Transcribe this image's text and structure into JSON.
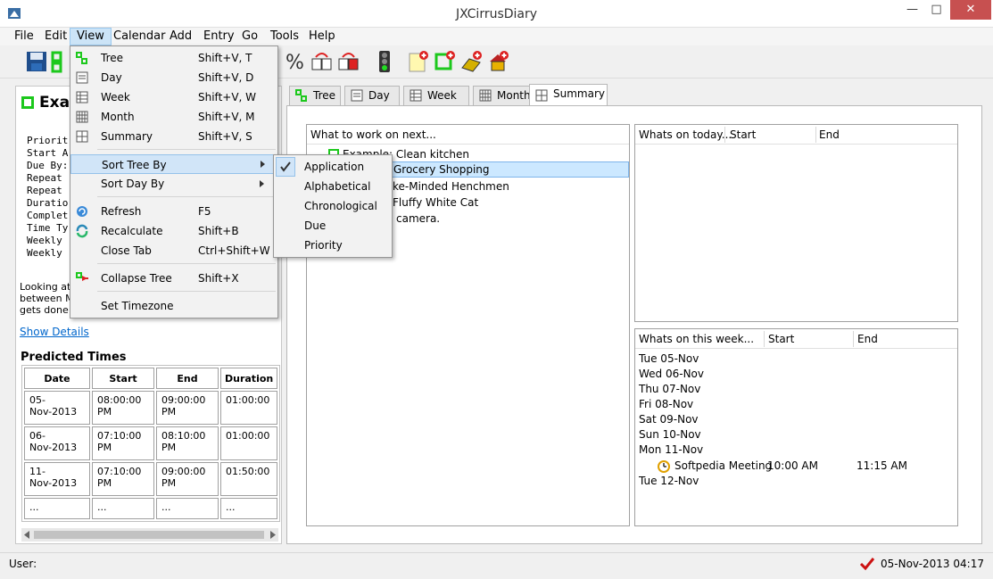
{
  "window": {
    "title": "JXCirrusDiary",
    "minimize": "—",
    "maximize": "□",
    "close": "✕"
  },
  "menubar": [
    "File",
    "Edit",
    "View",
    "Calendar",
    "Add",
    "Entry",
    "Go",
    "Tools",
    "Help"
  ],
  "left": {
    "entry_title": "Exa",
    "fields": [
      "Priorit",
      "Start A",
      "Due By:",
      "Repeat",
      "Repeat",
      "Duratio",
      "Complet",
      "Time Ty",
      "Weekly",
      "Weekly"
    ],
    "description": "Looking at t\nbetween Mo\ngets done b",
    "show_details": "Show Details",
    "predicted_title": "Predicted Times",
    "columns": [
      "Date",
      "Start",
      "End",
      "Duration"
    ],
    "rows": [
      [
        "05-\nNov-2013",
        "08:00:00\nPM",
        "09:00:00\nPM",
        "01:00:00"
      ],
      [
        "06-\nNov-2013",
        "07:10:00\nPM",
        "08:10:00\nPM",
        "01:00:00"
      ],
      [
        "11-\nNov-2013",
        "07:10:00\nPM",
        "09:00:00\nPM",
        "01:50:00"
      ],
      [
        "...",
        "...",
        "...",
        "..."
      ]
    ]
  },
  "tabs": [
    "Tree",
    "Day",
    "Week",
    "Month",
    "Summary"
  ],
  "work_next": {
    "header": "What to work on next...",
    "items": [
      "Example: Clean kitchen",
      "Grocery Shopping",
      "ke-Minded Henchmen",
      "Fluffy White Cat",
      "camera."
    ]
  },
  "today": {
    "header": "Whats on today...",
    "start": "Start",
    "end": "End"
  },
  "week": {
    "header": "Whats on this week...",
    "start": "Start",
    "end": "End",
    "days": [
      "Tue 05-Nov",
      "Wed 06-Nov",
      "Thu 07-Nov",
      "Fri 08-Nov",
      "Sat 09-Nov",
      "Sun 10-Nov",
      "Mon 11-Nov"
    ],
    "event": {
      "name": "Softpedia Meeting",
      "start": "10:00 AM",
      "end": "11:15 AM"
    },
    "last_day": "Tue 12-Nov"
  },
  "view_menu": {
    "items": [
      {
        "label": "Tree",
        "shortcut": "Shift+V, T"
      },
      {
        "label": "Day",
        "shortcut": "Shift+V, D"
      },
      {
        "label": "Week",
        "shortcut": "Shift+V, W"
      },
      {
        "label": "Month",
        "shortcut": "Shift+V, M"
      },
      {
        "label": "Summary",
        "shortcut": "Shift+V, S"
      },
      {
        "label": "Sort Tree By",
        "shortcut": ""
      },
      {
        "label": "Sort Day By",
        "shortcut": ""
      },
      {
        "label": "Refresh",
        "shortcut": "F5"
      },
      {
        "label": "Recalculate",
        "shortcut": "Shift+B"
      },
      {
        "label": "Close Tab",
        "shortcut": "Ctrl+Shift+W"
      },
      {
        "label": "Collapse Tree",
        "shortcut": "Shift+X"
      },
      {
        "label": "Set Timezone",
        "shortcut": ""
      }
    ]
  },
  "sort_menu": {
    "items": [
      "Application",
      "Alphabetical",
      "Chronological",
      "Due",
      "Priority"
    ],
    "checked": "Application"
  },
  "status": {
    "user_label": "User:",
    "datetime": "05-Nov-2013 04:17"
  }
}
